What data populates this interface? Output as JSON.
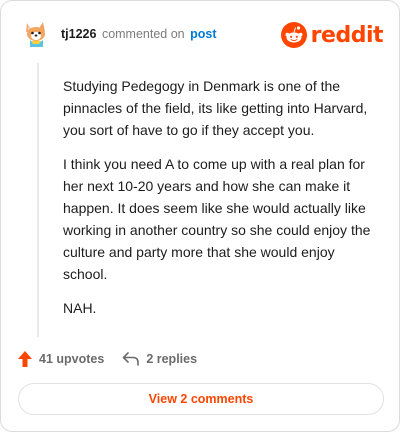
{
  "header": {
    "username": "tj1226",
    "action": "commented on",
    "post_link": "post",
    "brand": "reddit"
  },
  "comment": {
    "paragraphs": [
      "Studying Pedegogy in Denmark is one of the pinnacles of the field, its like getting into Harvard, you sort of have to go if they accept you.",
      "I think you need A to come up with a real plan for her next 10-20 years and how she can make it happen. It does seem like she would actually like working in another country so she could enjoy the culture and party more that she would enjoy school.",
      "NAH."
    ]
  },
  "actions": {
    "upvotes": "41 upvotes",
    "replies": "2 replies"
  },
  "view_comments": "View 2 comments",
  "colors": {
    "brand": "#ff4500",
    "link": "#0079d3"
  },
  "icons": [
    "avatar-dog-icon",
    "reddit-snoo-icon",
    "upvote-arrow-icon",
    "reply-icon"
  ]
}
